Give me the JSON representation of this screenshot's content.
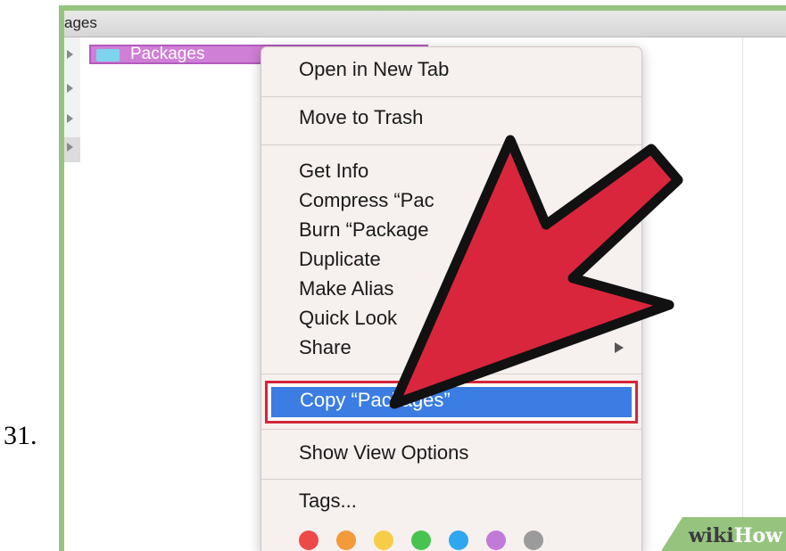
{
  "step": {
    "number": "31."
  },
  "window": {
    "title": "ages"
  },
  "sidebar": {
    "selected_item": {
      "label": "Packages"
    }
  },
  "context_menu": {
    "items": [
      {
        "label": "Open in New Tab"
      },
      {
        "label": "Move to Trash"
      },
      {
        "label": "Get Info"
      },
      {
        "label": "Compress “Pac"
      },
      {
        "label": "Burn “Package"
      },
      {
        "label": "Duplicate"
      },
      {
        "label": "Make Alias"
      },
      {
        "label": "Quick Look"
      },
      {
        "label": "Share"
      },
      {
        "label": "Copy “Packages”"
      },
      {
        "label": "Show View Options"
      },
      {
        "label": "Tags..."
      }
    ],
    "tag_colors": [
      "#ef4848",
      "#f39a3b",
      "#f5cd47",
      "#47c44f",
      "#2fa7ee",
      "#c27ad8",
      "#9b9b9b"
    ]
  },
  "annotation": {
    "arrow_color": "#d9263c",
    "highlight_color": "#d3263a"
  },
  "watermark": {
    "wiki": "wiki",
    "how": "How"
  }
}
